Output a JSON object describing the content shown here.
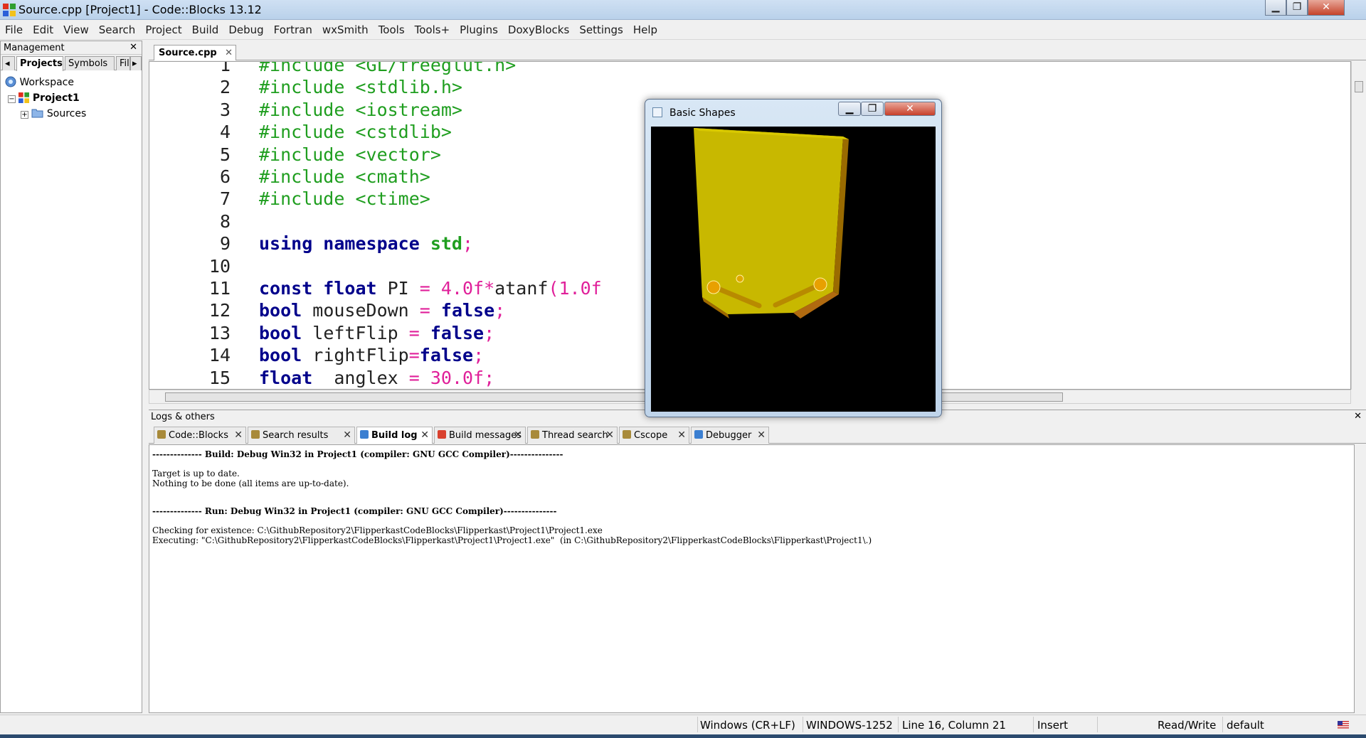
{
  "window": {
    "title": "Source.cpp [Project1] - Code::Blocks 13.12",
    "minimize": "▁",
    "maximize": "❐",
    "close": "✕"
  },
  "menu": [
    "File",
    "Edit",
    "View",
    "Search",
    "Project",
    "Build",
    "Debug",
    "Fortran",
    "wxSmith",
    "Tools",
    "Tools+",
    "Plugins",
    "DoxyBlocks",
    "Settings",
    "Help"
  ],
  "management": {
    "title": "Management",
    "close": "✕",
    "tabs": {
      "left_arrow": "◂",
      "projects": "Projects",
      "symbols": "Symbols",
      "files": "Fil",
      "right_arrow": "▸"
    },
    "tree": {
      "workspace": "Workspace",
      "project": "Project1",
      "sources": "Sources",
      "expand_project": "−",
      "expand_sources": "+"
    }
  },
  "editor": {
    "tab": "Source.cpp",
    "tab_close": "✕",
    "line_numbers": [
      "1",
      "2",
      "3",
      "4",
      "5",
      "6",
      "7",
      "8",
      "9",
      "10",
      "11",
      "12",
      "13",
      "14",
      "15"
    ],
    "lines": [
      [
        {
          "t": "#include <GL/freeglut.h>",
          "c": "#1f9e1f"
        }
      ],
      [
        {
          "t": "#include <stdlib.h>",
          "c": "#1f9e1f"
        }
      ],
      [
        {
          "t": "#include <iostream>",
          "c": "#1f9e1f"
        }
      ],
      [
        {
          "t": "#include <cstdlib>",
          "c": "#1f9e1f"
        }
      ],
      [
        {
          "t": "#include <vector>",
          "c": "#1f9e1f"
        }
      ],
      [
        {
          "t": "#include <cmath>",
          "c": "#1f9e1f"
        }
      ],
      [
        {
          "t": "#include <ctime>",
          "c": "#1f9e1f"
        }
      ],
      [],
      [
        {
          "t": "using namespace ",
          "c": "#00008b",
          "b": true
        },
        {
          "t": "std",
          "c": "#1f9e1f",
          "b": true
        },
        {
          "t": ";",
          "c": "#e0209a"
        }
      ],
      [],
      [
        {
          "t": "const float ",
          "c": "#00008b",
          "b": true
        },
        {
          "t": "PI ",
          "c": "#222"
        },
        {
          "t": "= ",
          "c": "#e0209a"
        },
        {
          "t": "4.0f",
          "c": "#e0209a"
        },
        {
          "t": "*",
          "c": "#e0209a"
        },
        {
          "t": "atanf",
          "c": "#222"
        },
        {
          "t": "(1.0f",
          "c": "#e0209a"
        }
      ],
      [
        {
          "t": "bool ",
          "c": "#00008b",
          "b": true
        },
        {
          "t": "mouseDown ",
          "c": "#222"
        },
        {
          "t": "= ",
          "c": "#e0209a"
        },
        {
          "t": "false",
          "c": "#00008b",
          "b": true
        },
        {
          "t": ";",
          "c": "#e0209a"
        }
      ],
      [
        {
          "t": "bool ",
          "c": "#00008b",
          "b": true
        },
        {
          "t": "leftFlip ",
          "c": "#222"
        },
        {
          "t": "= ",
          "c": "#e0209a"
        },
        {
          "t": "false",
          "c": "#00008b",
          "b": true
        },
        {
          "t": ";",
          "c": "#e0209a"
        }
      ],
      [
        {
          "t": "bool ",
          "c": "#00008b",
          "b": true
        },
        {
          "t": "rightFlip",
          "c": "#222"
        },
        {
          "t": "=",
          "c": "#e0209a"
        },
        {
          "t": "false",
          "c": "#00008b",
          "b": true
        },
        {
          "t": ";",
          "c": "#e0209a"
        }
      ],
      [
        {
          "t": "float ",
          "c": "#00008b",
          "b": true
        },
        {
          "t": " anglex ",
          "c": "#222"
        },
        {
          "t": "= ",
          "c": "#e0209a"
        },
        {
          "t": "30.0f",
          "c": "#e0209a"
        },
        {
          "t": ";",
          "c": "#e0209a"
        }
      ]
    ]
  },
  "logs": {
    "title": "Logs & others",
    "close": "✕",
    "tabs": [
      {
        "label": "Code::Blocks",
        "active": false
      },
      {
        "label": "Search results",
        "active": false
      },
      {
        "label": "Build log",
        "active": true
      },
      {
        "label": "Build messages",
        "active": false
      },
      {
        "label": "Thread search",
        "active": false
      },
      {
        "label": "Cscope",
        "active": false
      },
      {
        "label": "Debugger",
        "active": false
      }
    ],
    "tab_close": "✕",
    "lines": [
      "-------------- Build: Debug Win32 in Project1 (compiler: GNU GCC Compiler)---------------",
      "",
      "Target is up to date.",
      "Nothing to be done (all items are up-to-date).",
      "",
      "",
      "-------------- Run: Debug Win32 in Project1 (compiler: GNU GCC Compiler)---------------",
      "",
      "Checking for existence: C:\\GithubRepository2\\FlipperkastCodeBlocks\\Flipperkast\\Project1\\Project1.exe",
      "Executing: \"C:\\GithubRepository2\\FlipperkastCodeBlocks\\Flipperkast\\Project1\\Project1.exe\"  (in C:\\GithubRepository2\\FlipperkastCodeBlocks\\Flipperkast\\Project1\\.)"
    ]
  },
  "status": {
    "eol": "Windows (CR+LF)",
    "encoding": "WINDOWS-1252",
    "position": "Line 16, Column 21",
    "mode": "Insert",
    "access": "Read/Write",
    "profile": "default"
  },
  "basic_shapes": {
    "title": "Basic Shapes",
    "minimize": "▁",
    "maximize": "❐",
    "close": "✕"
  },
  "colors": {
    "accent_title": "#b9d1ea",
    "include": "#1f9e1f",
    "keyword": "#00008b",
    "operator": "#e0209a",
    "board": "#c8b800"
  }
}
